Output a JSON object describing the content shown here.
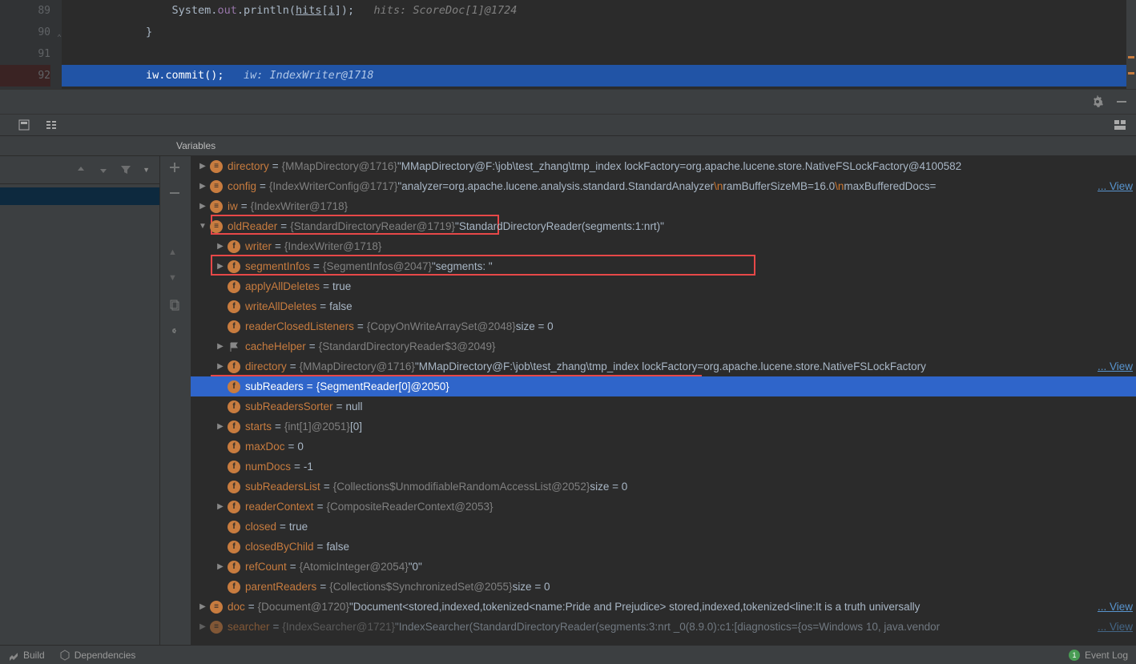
{
  "editor": {
    "lines": [
      {
        "num": "89",
        "code": "            System.out.println(hits[i]);",
        "hint": "   hits: ScoreDoc[1]@1724"
      },
      {
        "num": "90",
        "code": "        }",
        "hint": ""
      },
      {
        "num": "91",
        "code": "",
        "hint": ""
      },
      {
        "num": "92",
        "code": "        iw.commit();",
        "hint": "   iw: IndexWriter@1718",
        "exec": true,
        "bp": true
      }
    ]
  },
  "varsHeader": "Variables",
  "vars": [
    {
      "d": 0,
      "arr": "▶",
      "ic": "o",
      "name": "directory",
      "eq": " = ",
      "type": "{MMapDirectory@1716}",
      "val": " \"MMapDirectory@F:\\job\\test_zhang\\tmp_index lockFactory=org.apache.lucene.store.NativeFSLockFactory@4100582"
    },
    {
      "d": 0,
      "arr": "▶",
      "ic": "o",
      "name": "config",
      "eq": " = ",
      "type": "{IndexWriterConfig@1717}",
      "val": " \"analyzer=org.apache.lucene.analysis.standard.StandardAnalyzer",
      "esc1": "\\n",
      "val2": "ramBufferSizeMB=16.0",
      "esc2": "\\n",
      "val3": "maxBufferedDocs=",
      "link": "... View"
    },
    {
      "d": 0,
      "arr": "▶",
      "ic": "o",
      "name": "iw",
      "eq": " = ",
      "type": "{IndexWriter@1718}",
      "val": ""
    },
    {
      "d": 0,
      "arr": "▼",
      "ic": "o",
      "name": "oldReader",
      "eq": " = ",
      "type": "{StandardDirectoryReader@1719}",
      "val": " \"StandardDirectoryReader(segments:1:nrt)\""
    },
    {
      "d": 1,
      "arr": "▶",
      "ic": "f",
      "name": "writer",
      "eq": " = ",
      "type": "{IndexWriter@1718}",
      "val": ""
    },
    {
      "d": 1,
      "arr": "▶",
      "ic": "f",
      "name": "segmentInfos",
      "eq": " = ",
      "type": "{SegmentInfos@2047}",
      "val": " \"segments: \""
    },
    {
      "d": 1,
      "arr": "",
      "ic": "f",
      "name": "applyAllDeletes",
      "eq": " = ",
      "type": "",
      "val": "true"
    },
    {
      "d": 1,
      "arr": "",
      "ic": "f",
      "name": "writeAllDeletes",
      "eq": " = ",
      "type": "",
      "val": "false"
    },
    {
      "d": 1,
      "arr": "",
      "ic": "f",
      "name": "readerClosedListeners",
      "eq": " = ",
      "type": "{CopyOnWriteArraySet@2048}",
      "val": "  size = 0"
    },
    {
      "d": 1,
      "arr": "▶",
      "ic": "flag",
      "name": "cacheHelper",
      "eq": " = ",
      "type": "{StandardDirectoryReader$3@2049}",
      "val": ""
    },
    {
      "d": 1,
      "arr": "▶",
      "ic": "f",
      "name": "directory",
      "eq": " = ",
      "type": "{MMapDirectory@1716}",
      "val": " \"MMapDirectory@F:\\job\\test_zhang\\tmp_index lockFactory=org.apache.lucene.store.NativeFSLockFactory",
      "link": "... View"
    },
    {
      "d": 1,
      "arr": "",
      "ic": "f",
      "name": "subReaders",
      "eq": " = ",
      "type": "{SegmentReader[0]@2050}",
      "val": "",
      "sel": true
    },
    {
      "d": 1,
      "arr": "",
      "ic": "f",
      "name": "subReadersSorter",
      "eq": " = ",
      "type": "",
      "val": "null"
    },
    {
      "d": 1,
      "arr": "▶",
      "ic": "f",
      "name": "starts",
      "eq": " = ",
      "type": "{int[1]@2051}",
      "val": " [0]"
    },
    {
      "d": 1,
      "arr": "",
      "ic": "f",
      "name": "maxDoc",
      "eq": " = ",
      "type": "",
      "val": "0"
    },
    {
      "d": 1,
      "arr": "",
      "ic": "f",
      "name": "numDocs",
      "eq": " = ",
      "type": "",
      "val": "-1"
    },
    {
      "d": 1,
      "arr": "",
      "ic": "f",
      "name": "subReadersList",
      "eq": " = ",
      "type": "{Collections$UnmodifiableRandomAccessList@2052}",
      "val": "  size = 0"
    },
    {
      "d": 1,
      "arr": "▶",
      "ic": "f",
      "name": "readerContext",
      "eq": " = ",
      "type": "{CompositeReaderContext@2053}",
      "val": ""
    },
    {
      "d": 1,
      "arr": "",
      "ic": "f",
      "name": "closed",
      "eq": " = ",
      "type": "",
      "val": "true"
    },
    {
      "d": 1,
      "arr": "",
      "ic": "f",
      "name": "closedByChild",
      "eq": " = ",
      "type": "",
      "val": "false"
    },
    {
      "d": 1,
      "arr": "▶",
      "ic": "f",
      "name": "refCount",
      "eq": " = ",
      "type": "{AtomicInteger@2054}",
      "val": " \"0\""
    },
    {
      "d": 1,
      "arr": "",
      "ic": "f",
      "name": "parentReaders",
      "eq": " = ",
      "type": "{Collections$SynchronizedSet@2055}",
      "val": "  size = 0"
    },
    {
      "d": 0,
      "arr": "▶",
      "ic": "o",
      "name": "doc",
      "eq": " = ",
      "type": "{Document@1720}",
      "val": " \"Document<stored,indexed,tokenized<name:Pride and Prejudice> stored,indexed,tokenized<line:It is a truth universally ",
      "link": "... View"
    },
    {
      "d": 0,
      "arr": "▶",
      "ic": "o",
      "name": "searcher",
      "eq": " = ",
      "type": "{IndexSearcher@1721}",
      "val": " \"IndexSearcher(StandardDirectoryReader(segments:3:nrt _0(8.9.0):c1:[diagnostics={os=Windows 10, java.vendor",
      "link": "... View",
      "fade": true
    }
  ],
  "bottom": {
    "build": "Build",
    "deps": "Dependencies",
    "eventlog": "Event Log",
    "badge": "1"
  }
}
